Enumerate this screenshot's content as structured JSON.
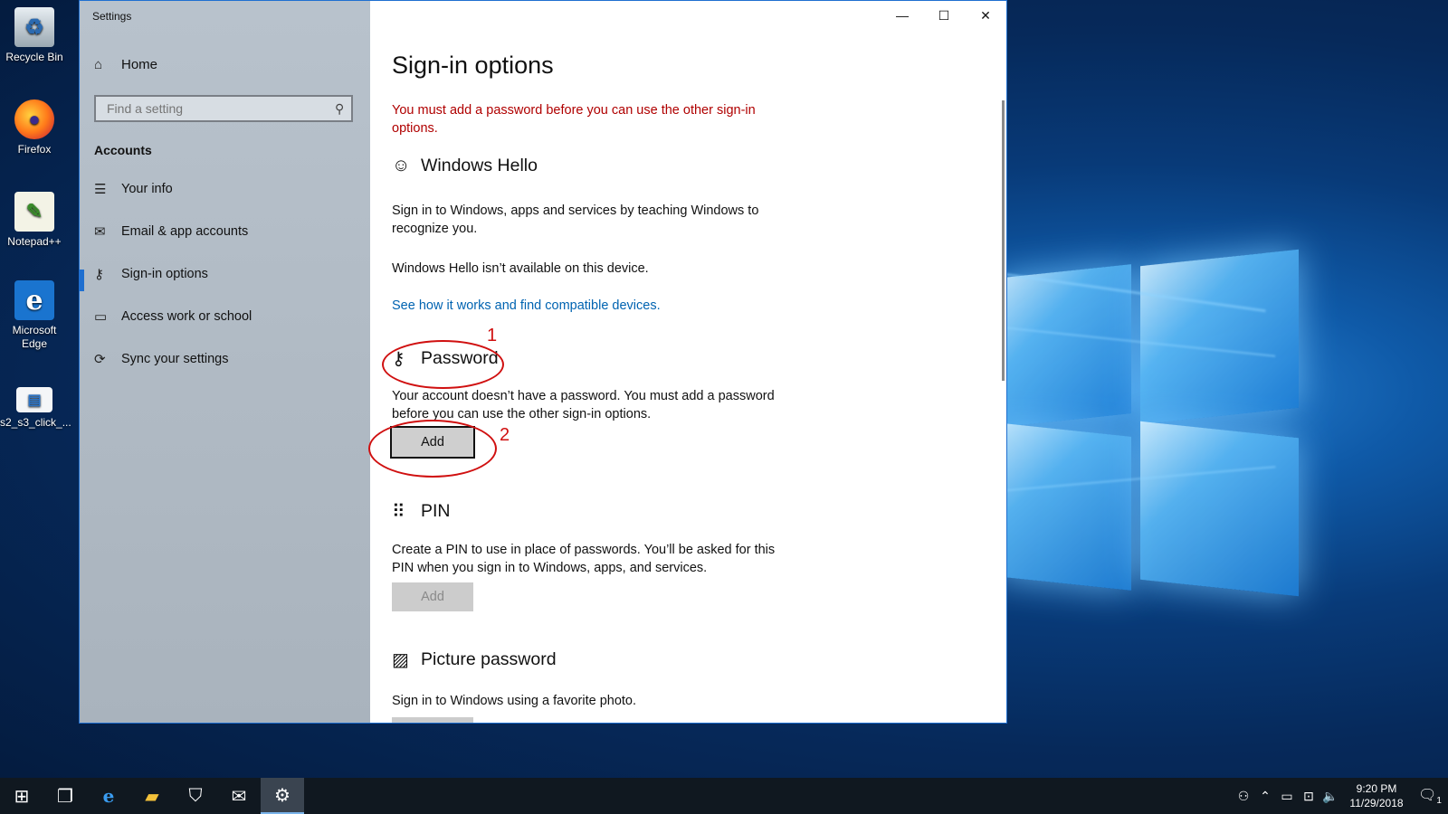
{
  "desktop": {
    "icons": [
      {
        "label": "Recycle Bin"
      },
      {
        "label": "Firefox"
      },
      {
        "label": "Notepad++"
      },
      {
        "label": "Microsoft Edge"
      },
      {
        "label": "s2_s3_click_..."
      }
    ]
  },
  "window": {
    "title": "Settings",
    "controls": {
      "minimize": "—",
      "maximize": "☐",
      "close": "✕"
    }
  },
  "sidebar": {
    "home": "Home",
    "search_placeholder": "Find a setting",
    "section": "Accounts",
    "items": [
      {
        "label": "Your info",
        "icon": "person-card-icon"
      },
      {
        "label": "Email & app accounts",
        "icon": "mail-icon"
      },
      {
        "label": "Sign-in options",
        "icon": "key-icon",
        "active": true
      },
      {
        "label": "Access work or school",
        "icon": "briefcase-icon"
      },
      {
        "label": "Sync your settings",
        "icon": "sync-icon"
      }
    ]
  },
  "content": {
    "title": "Sign-in options",
    "warning": "You must add a password before you can use the other sign-in options.",
    "hello": {
      "heading": "Windows Hello",
      "desc": "Sign in to Windows, apps and services by teaching Windows to recognize you.",
      "unavailable": "Windows Hello isn’t available on this device.",
      "link": "See how it works and find compatible devices."
    },
    "password": {
      "heading": "Password",
      "desc": "Your account doesn’t have a password. You must add a password before you can use the other sign-in options.",
      "button": "Add"
    },
    "pin": {
      "heading": "PIN",
      "desc": "Create a PIN to use in place of passwords. You’ll be asked for this PIN when you sign in to Windows, apps, and services.",
      "button": "Add"
    },
    "picture": {
      "heading": "Picture password",
      "desc": "Sign in to Windows using a favorite photo."
    }
  },
  "annotations": {
    "one": "1",
    "two": "2",
    "color": "#d01010"
  },
  "taskbar": {
    "clock_time": "9:20 PM",
    "clock_date": "11/29/2018",
    "notification_count": "1"
  },
  "colors": {
    "accent": "#1f6fd0",
    "link": "#0063b1",
    "warning": "#b00000"
  }
}
